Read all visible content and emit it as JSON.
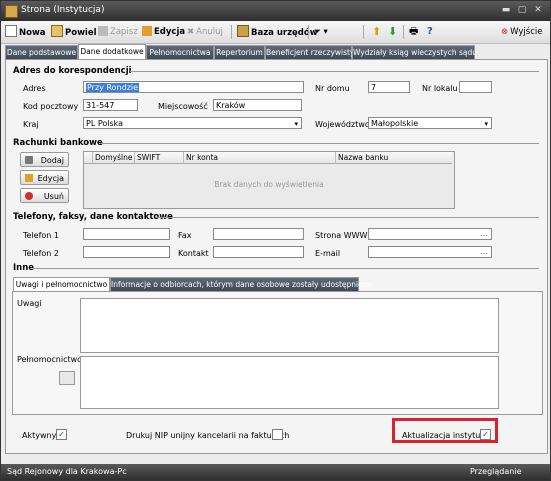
{
  "window": {
    "title": "Strona (Instytucja)"
  },
  "toolbar": {
    "nowa": "Nowa",
    "powiel": "Powiel",
    "zapisz": "Zapisz",
    "edycja": "Edycja",
    "anuluj": "Anuluj",
    "baza": "Baza urzędów",
    "wyjscie": "Wyjście"
  },
  "tabs": [
    "Dane podstawowe",
    "Dane dodatkowe",
    "Pełnomocnictwa",
    "Repertorium",
    "Beneficjent rzeczywisty",
    "Wydziały ksiąg wieczystych sądu"
  ],
  "address": {
    "section": "Adres do korespondencji",
    "adres_label": "Adres",
    "adres_value": "Przy Rondzie",
    "nrdomu_label": "Nr domu",
    "nrdomu_value": "7",
    "nrlokalu_label": "Nr lokalu",
    "nrlokalu_value": "",
    "kod_label": "Kod pocztowy",
    "kod_value": "31-547",
    "miejsc_label": "Miejscowość",
    "miejsc_value": "Kraków",
    "kraj_label": "Kraj",
    "kraj_value": "PL Polska",
    "woj_label": "Województwo",
    "woj_value": "Małopolskie"
  },
  "bank": {
    "section": "Rachunki bankowe",
    "dodaj": "Dodaj",
    "edycja": "Edycja",
    "usun": "Usuń",
    "columns": [
      "Domyślne",
      "SWIFT",
      "Nr konta",
      "Nazwa banku"
    ],
    "empty": "Brak danych do wyświetlenia"
  },
  "contact": {
    "section": "Telefony, faksy, dane kontaktowe",
    "tel1": "Telefon 1",
    "tel2": "Telefon 2",
    "fax": "Fax",
    "kontakt": "Kontakt",
    "www": "Strona WWW",
    "email": "E-mail"
  },
  "other": {
    "section": "Inne",
    "tab1": "Uwagi i pełnomocnictwo",
    "tab2": "Informacje o odbiorcach, którym dane osobowe zostały udostępnione",
    "uwagi": "Uwagi",
    "pelnomocnictwo": "Pełnomocnictwo"
  },
  "footer": {
    "aktywny": "Aktywny",
    "aktywny_checked": true,
    "nip": "Drukuj NIP unijny kancelarii na fakturach",
    "nip_checked": false,
    "aktualizacja": "Aktualizacja instytucji",
    "aktualizacja_checked": true
  },
  "status": {
    "left": "Sąd Rejonowy dla Krakowa-Pc",
    "right": "Przeglądanie"
  },
  "colors": {
    "highlight": "#d9232a",
    "selection": "#3b7dd8"
  }
}
